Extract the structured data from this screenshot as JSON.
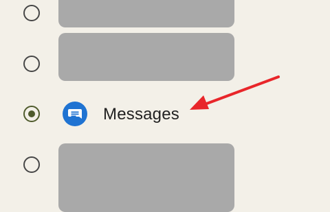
{
  "apps": [
    {
      "label": "",
      "selected": false,
      "redacted": true
    },
    {
      "label": "",
      "selected": false,
      "redacted": true
    },
    {
      "label": "Messages",
      "selected": true,
      "redacted": false,
      "icon": "messages-icon"
    },
    {
      "label": "",
      "selected": false,
      "redacted": true
    }
  ],
  "colors": {
    "background": "#f3f0e8",
    "radio_selected": "#4f5b2c",
    "radio_unselected": "#464646",
    "placeholder": "#a9a9a9",
    "messages_icon": "#1f73d2",
    "annotation_arrow": "#e8262a"
  },
  "annotation": {
    "icon": "arrow-annotation-icon"
  }
}
